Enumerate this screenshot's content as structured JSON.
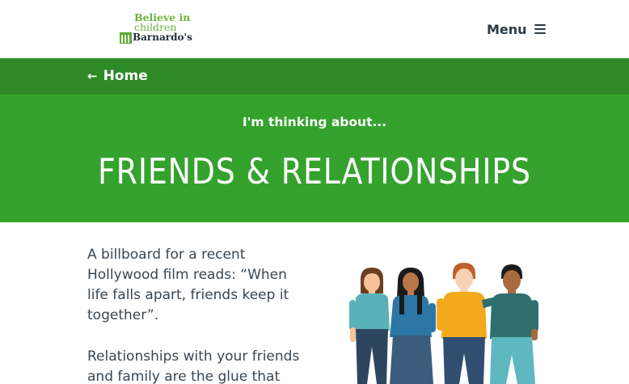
{
  "header": {
    "logo": {
      "line1": "Believe in",
      "line2": "children",
      "line3": "Barnardo's"
    },
    "menu_label": "Menu"
  },
  "breadcrumb": {
    "home_label": "Home"
  },
  "hero": {
    "kicker": "I'm thinking about...",
    "title": "FRIENDS & RELATIONSHIPS"
  },
  "content": {
    "paragraph1": "A billboard for a recent Hollywood film reads: “When life falls apart, friends keep it together”.",
    "paragraph2": "Relationships with your friends and family are the glue that"
  },
  "colors": {
    "header_bg": "#ffffff",
    "breadcrumb_bg": "#2d8a27",
    "hero_bg": "#35a22d",
    "brand_green": "#6cb33f",
    "text_dark": "#2b3a47"
  },
  "icons": {
    "menu": "hamburger-icon",
    "back": "arrow-left-icon"
  }
}
